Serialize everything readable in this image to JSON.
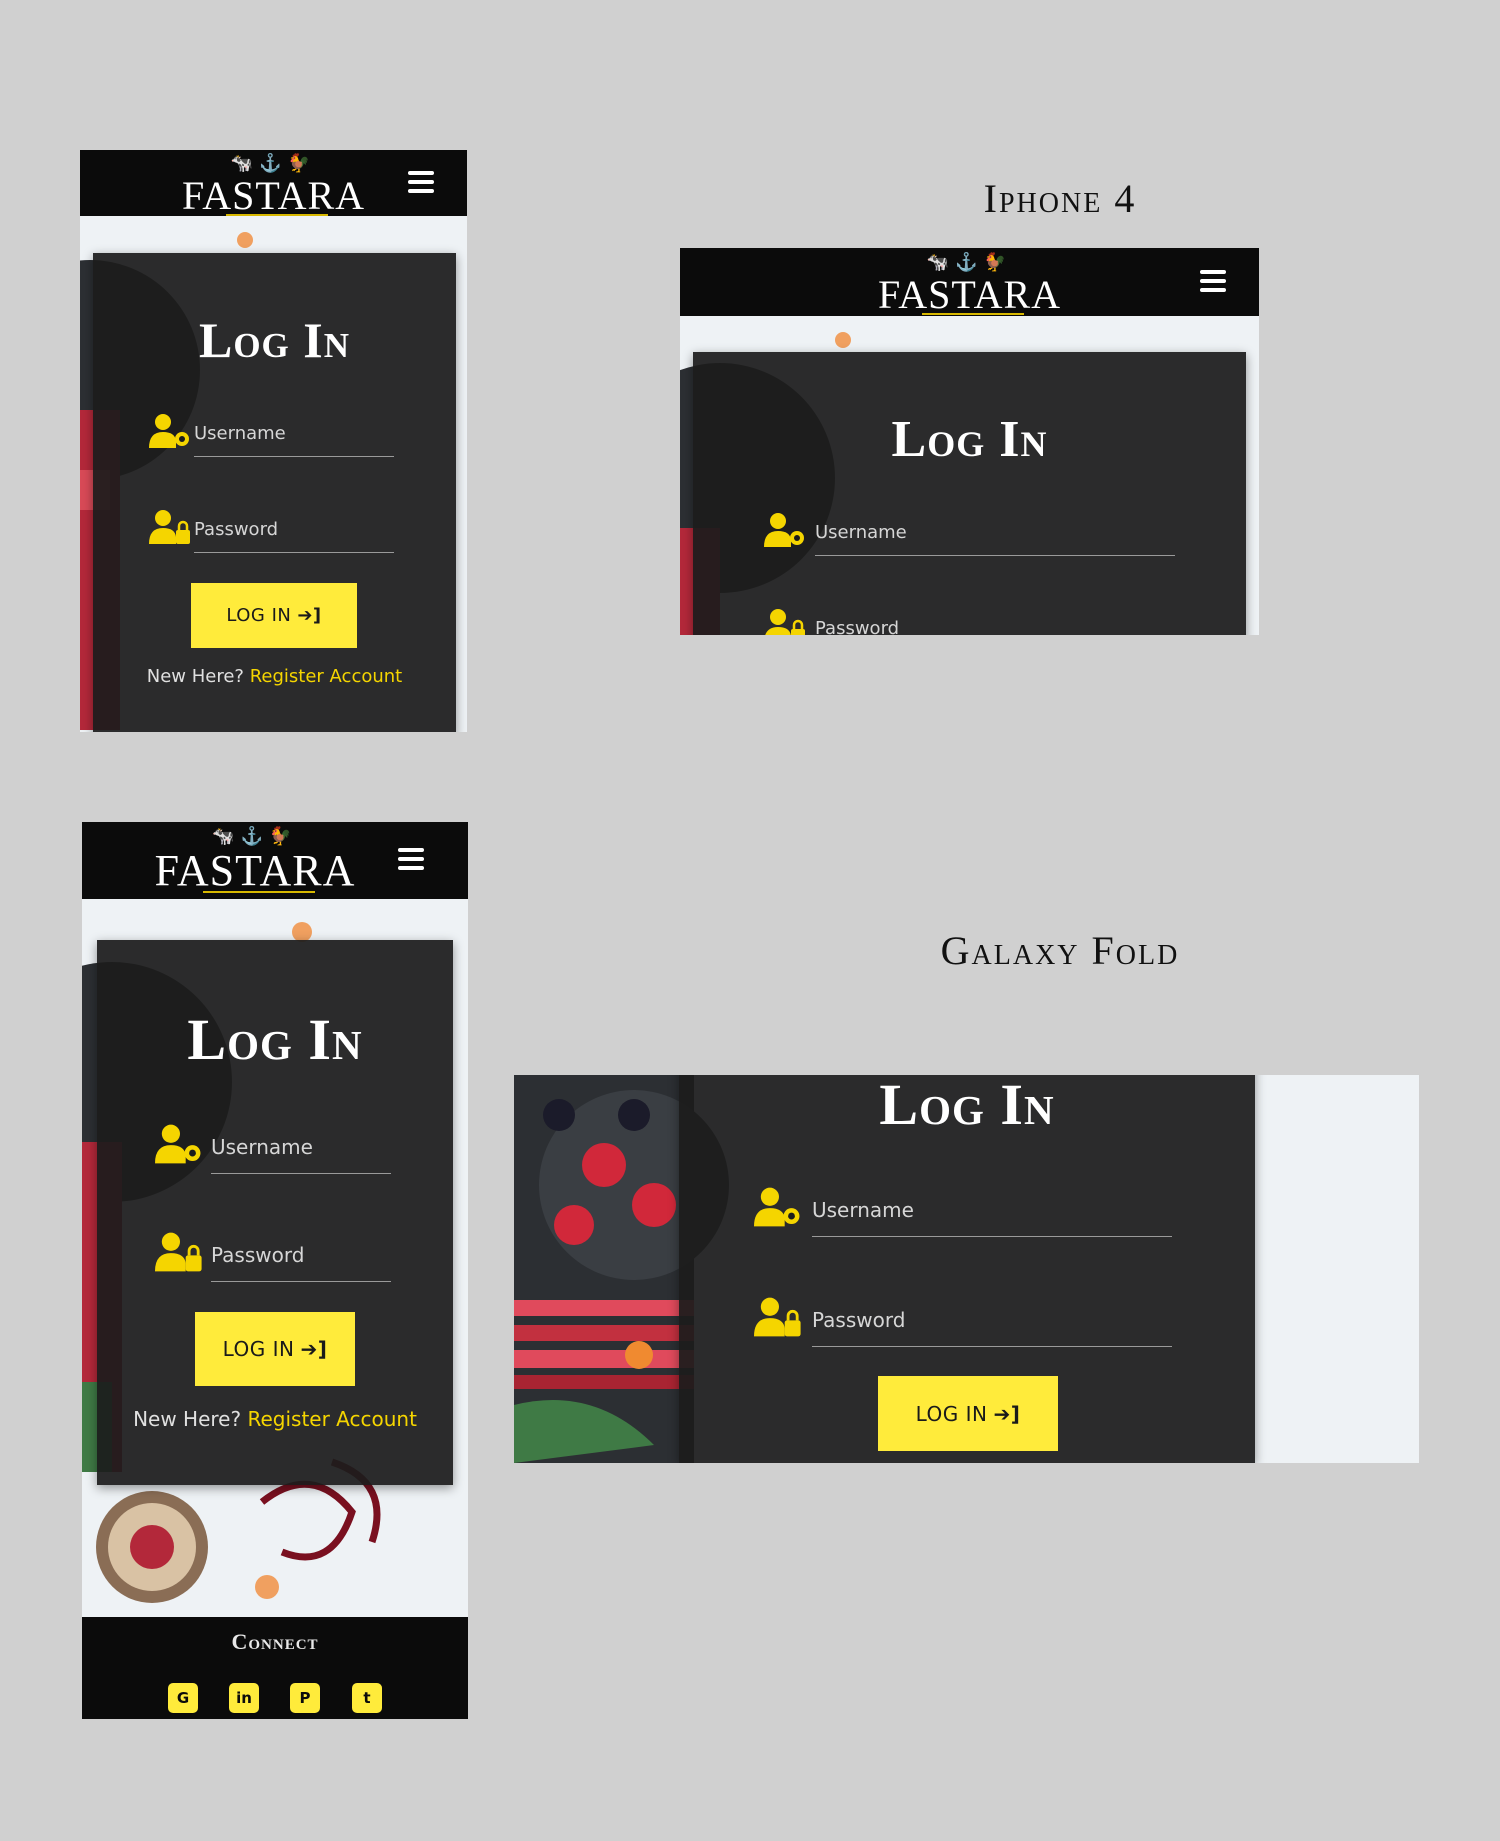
{
  "brand": {
    "name": "FASTARA",
    "icons": "🐄⚓🐓"
  },
  "captions": {
    "iphone4": "Iphone 4",
    "galaxy_fold": "Galaxy Fold"
  },
  "login": {
    "title": "Log In",
    "username_label": "Username",
    "password_label": "Password",
    "button_label": "LOG IN",
    "new_here": "New Here?",
    "register_link": "Register Account"
  },
  "footer": {
    "title": "Connect",
    "socials": [
      "github",
      "linkedin",
      "pinterest",
      "twitter"
    ]
  },
  "colors": {
    "accent": "#ffeb3b",
    "nav": "#0b0b0b",
    "card": "#1c1c1c",
    "page": "#d0d0d0"
  }
}
